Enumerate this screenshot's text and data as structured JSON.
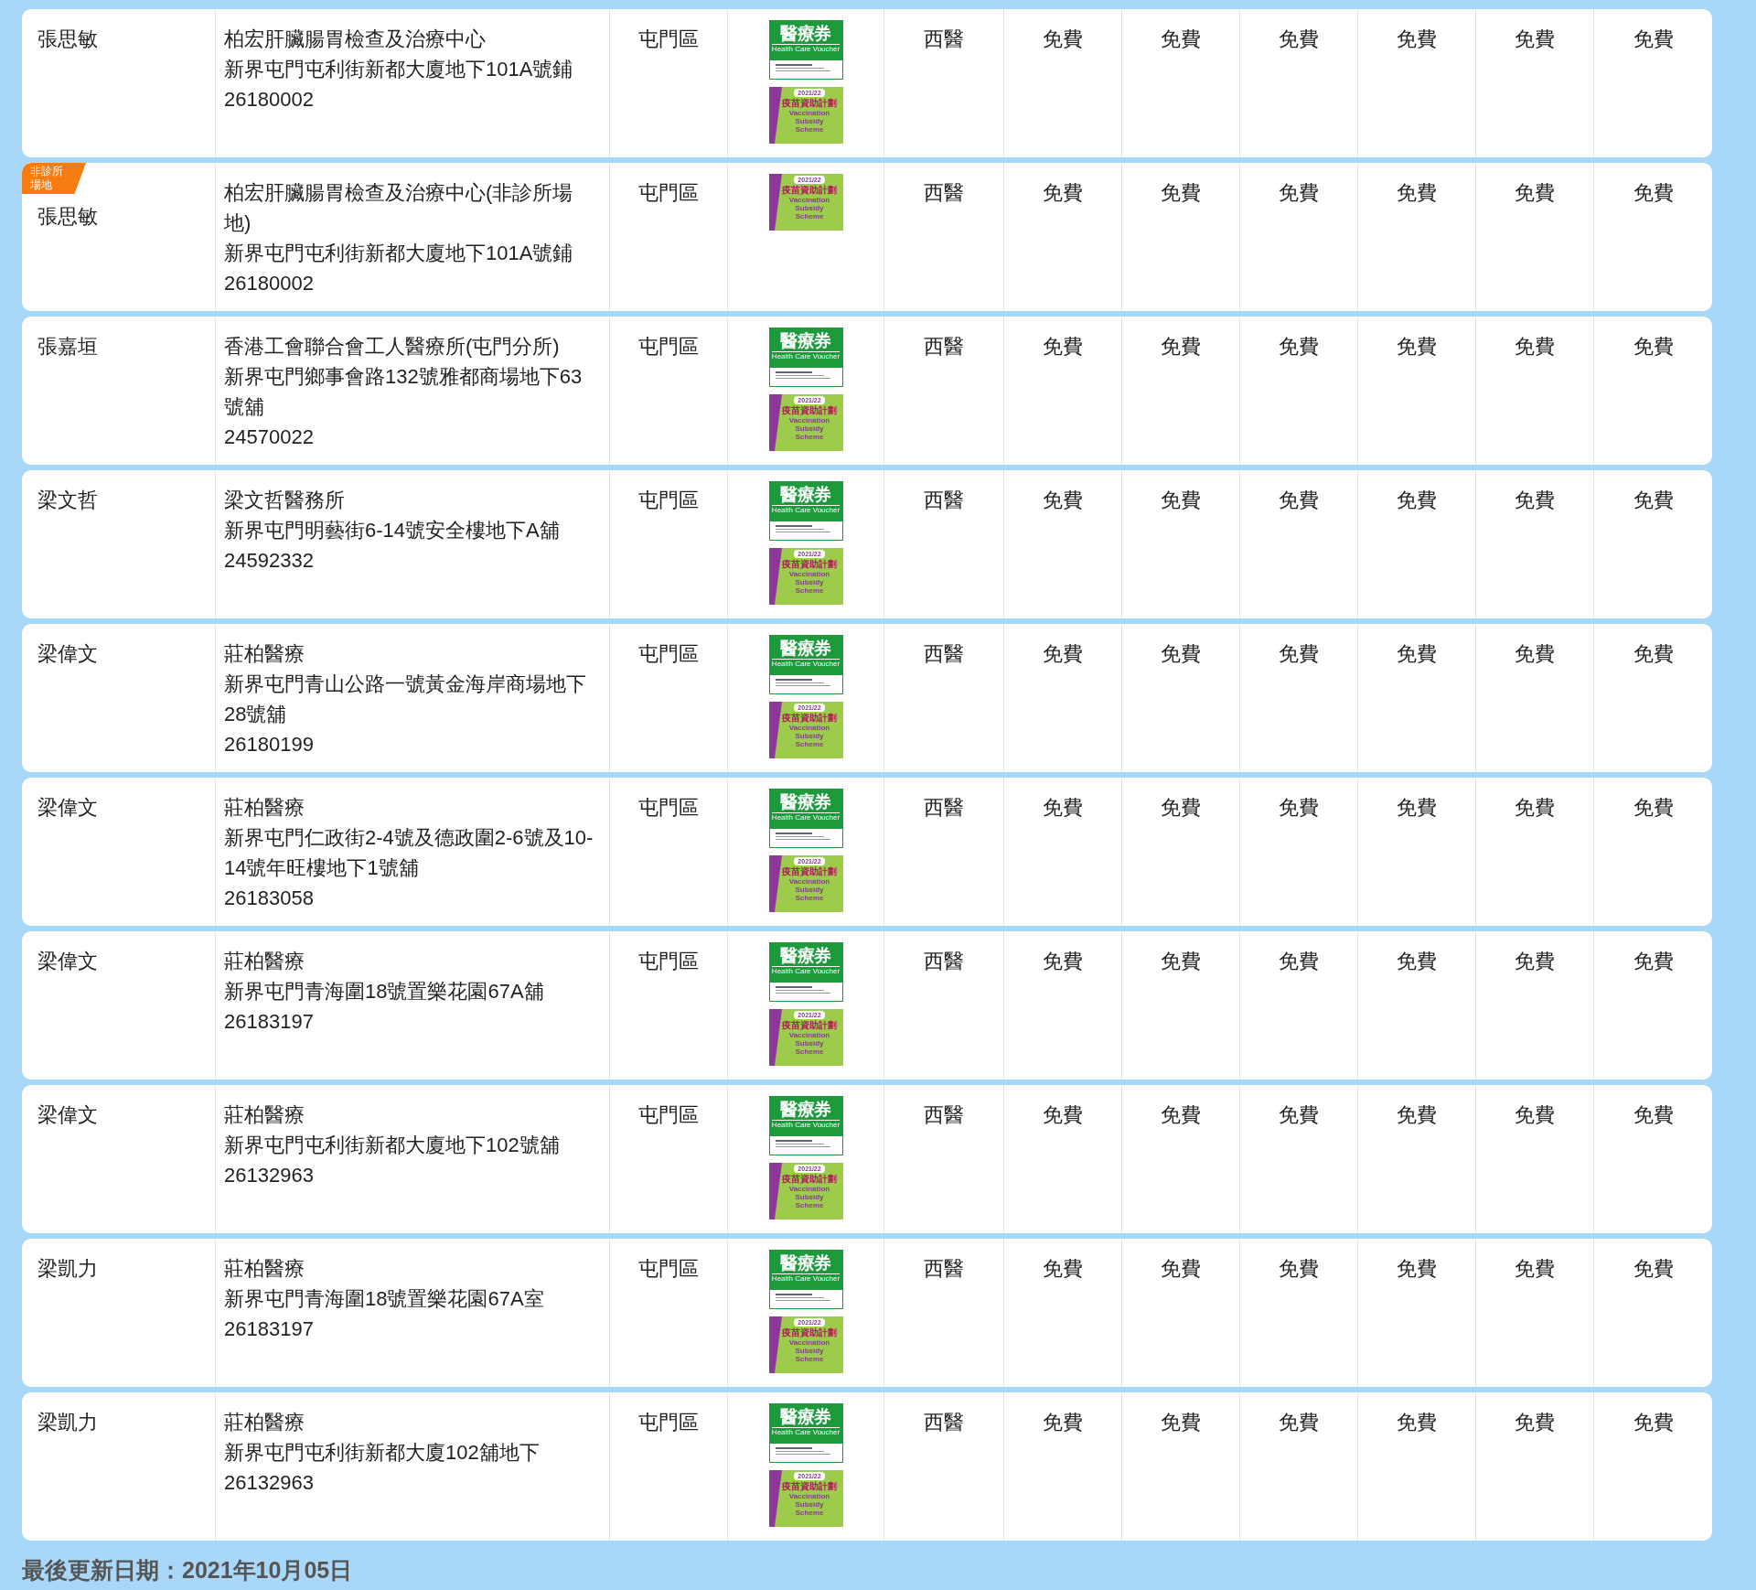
{
  "rows": [
    {
      "doctor": "張思敏",
      "clinic": [
        "柏宏肝臟腸胃檢查及治療中心",
        "新界屯門屯利街新都大廈地下101A號鋪",
        "26180002"
      ],
      "district": "屯門區",
      "logos": [
        {
          "kind": "voucher",
          "title": "醫療券",
          "subtitle": "Health Care Voucher"
        },
        {
          "kind": "vaccine",
          "year": "2021/22",
          "title": "疫苗資助計劃",
          "subtitle": "Vaccination Subsidy Scheme"
        }
      ],
      "cells": [
        "西醫",
        "免費",
        "免費",
        "免費",
        "免費",
        "免費",
        "免費"
      ]
    },
    {
      "tag": "非診所場地",
      "doctor": "張思敏",
      "clinic": [
        "柏宏肝臟腸胃檢查及治療中心(非診所場地)",
        "新界屯門屯利街新都大廈地下101A號鋪",
        "26180002"
      ],
      "district": "屯門區",
      "logos": [
        {
          "kind": "vaccine",
          "year": "2021/22",
          "title": "疫苗資助計劃",
          "subtitle": "Vaccination Subsidy Scheme"
        }
      ],
      "cells": [
        "西醫",
        "免費",
        "免費",
        "免費",
        "免費",
        "免費",
        "免費"
      ]
    },
    {
      "doctor": "張嘉垣",
      "clinic": [
        "香港工會聯合會工人醫療所(屯門分所)",
        "新界屯門鄉事會路132號雅都商場地下63號舖",
        "24570022"
      ],
      "district": "屯門區",
      "logos": [
        {
          "kind": "voucher",
          "title": "醫療券",
          "subtitle": "Health Care Voucher"
        },
        {
          "kind": "vaccine",
          "year": "2021/22",
          "title": "疫苗資助計劃",
          "subtitle": "Vaccination Subsidy Scheme"
        }
      ],
      "cells": [
        "西醫",
        "免費",
        "免費",
        "免費",
        "免費",
        "免費",
        "免費"
      ]
    },
    {
      "doctor": "梁文哲",
      "clinic": [
        "梁文哲醫務所",
        "新界屯門明藝街6-14號安全樓地下A舖",
        "24592332"
      ],
      "district": "屯門區",
      "logos": [
        {
          "kind": "voucher",
          "title": "醫療券",
          "subtitle": "Health Care Voucher"
        },
        {
          "kind": "vaccine",
          "year": "2021/22",
          "title": "疫苗資助計劃",
          "subtitle": "Vaccination Subsidy Scheme"
        }
      ],
      "cells": [
        "西醫",
        "免費",
        "免費",
        "免費",
        "免費",
        "免費",
        "免費"
      ]
    },
    {
      "doctor": "梁偉文",
      "clinic": [
        "莊柏醫療",
        "新界屯門青山公路一號黃金海岸商場地下28號舖",
        "26180199"
      ],
      "district": "屯門區",
      "logos": [
        {
          "kind": "voucher",
          "title": "醫療券",
          "subtitle": "Health Care Voucher"
        },
        {
          "kind": "vaccine",
          "year": "2021/22",
          "title": "疫苗資助計劃",
          "subtitle": "Vaccination Subsidy Scheme"
        }
      ],
      "cells": [
        "西醫",
        "免費",
        "免費",
        "免費",
        "免費",
        "免費",
        "免費"
      ]
    },
    {
      "doctor": "梁偉文",
      "clinic": [
        "莊柏醫療",
        "新界屯門仁政街2-4號及德政圍2-6號及10-14號年旺樓地下1號舖",
        "26183058"
      ],
      "district": "屯門區",
      "logos": [
        {
          "kind": "voucher",
          "title": "醫療券",
          "subtitle": "Health Care Voucher"
        },
        {
          "kind": "vaccine",
          "year": "2021/22",
          "title": "疫苗資助計劃",
          "subtitle": "Vaccination Subsidy Scheme"
        }
      ],
      "cells": [
        "西醫",
        "免費",
        "免費",
        "免費",
        "免費",
        "免費",
        "免費"
      ]
    },
    {
      "doctor": "梁偉文",
      "clinic": [
        "莊柏醫療",
        "新界屯門青海圍18號置樂花園67A舖",
        "26183197"
      ],
      "district": "屯門區",
      "logos": [
        {
          "kind": "voucher",
          "title": "醫療券",
          "subtitle": "Health Care Voucher"
        },
        {
          "kind": "vaccine",
          "year": "2021/22",
          "title": "疫苗資助計劃",
          "subtitle": "Vaccination Subsidy Scheme"
        }
      ],
      "cells": [
        "西醫",
        "免費",
        "免費",
        "免費",
        "免費",
        "免費",
        "免費"
      ]
    },
    {
      "doctor": "梁偉文",
      "clinic": [
        "莊柏醫療",
        "新界屯門屯利街新都大廈地下102號舖",
        "26132963"
      ],
      "district": "屯門區",
      "logos": [
        {
          "kind": "voucher",
          "title": "醫療券",
          "subtitle": "Health Care Voucher"
        },
        {
          "kind": "vaccine",
          "year": "2021/22",
          "title": "疫苗資助計劃",
          "subtitle": "Vaccination Subsidy Scheme"
        }
      ],
      "cells": [
        "西醫",
        "免費",
        "免費",
        "免費",
        "免費",
        "免費",
        "免費"
      ]
    },
    {
      "doctor": "梁凱力",
      "clinic": [
        "莊柏醫療",
        "新界屯門青海圍18號置樂花園67A室",
        "26183197"
      ],
      "district": "屯門區",
      "logos": [
        {
          "kind": "voucher",
          "title": "醫療券",
          "subtitle": "Health Care Voucher"
        },
        {
          "kind": "vaccine",
          "year": "2021/22",
          "title": "疫苗資助計劃",
          "subtitle": "Vaccination Subsidy Scheme"
        }
      ],
      "cells": [
        "西醫",
        "免費",
        "免費",
        "免費",
        "免費",
        "免費",
        "免費"
      ]
    },
    {
      "doctor": "梁凱力",
      "clinic": [
        "莊柏醫療",
        "新界屯門屯利街新都大廈102舖地下",
        "26132963"
      ],
      "district": "屯門區",
      "logos": [
        {
          "kind": "voucher",
          "title": "醫療券",
          "subtitle": "Health Care Voucher"
        },
        {
          "kind": "vaccine",
          "year": "2021/22",
          "title": "疫苗資助計劃",
          "subtitle": "Vaccination Subsidy Scheme"
        }
      ],
      "cells": [
        "西醫",
        "免費",
        "免費",
        "免費",
        "免費",
        "免費",
        "免費"
      ]
    }
  ],
  "footer": "最後更新日期：2021年10月05日"
}
